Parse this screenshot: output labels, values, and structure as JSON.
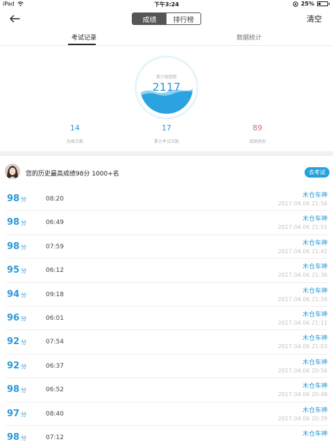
{
  "status_bar": {
    "device": "iPad",
    "time": "下午3:24",
    "battery": "25%"
  },
  "nav": {
    "segments": [
      "成绩",
      "排行榜"
    ],
    "active_segment": "成绩",
    "clear_label": "清空"
  },
  "tabs": [
    "考试记录",
    "数据统计"
  ],
  "summary": {
    "circle_label": "累计做题数",
    "circle_value": "2117",
    "stats": [
      {
        "value": "14",
        "label": "及格次数",
        "color": "#2a98d6"
      },
      {
        "value": "17",
        "label": "累计考试次数",
        "color": "#2a98d6"
      },
      {
        "value": "89",
        "label": "成绩预测",
        "color": "#e06a6a"
      }
    ]
  },
  "profile": {
    "best_text": "您的历史最高成绩98分  1000+名",
    "exam_button": "去考试"
  },
  "records": [
    {
      "score": "98",
      "unit": "分",
      "time": "08:20",
      "name": "木仓车神",
      "date": "2017.04.06 21:56"
    },
    {
      "score": "98",
      "unit": "分",
      "time": "06:49",
      "name": "木仓车神",
      "date": "2017.04.06 21:51"
    },
    {
      "score": "98",
      "unit": "分",
      "time": "07:59",
      "name": "木仓车神",
      "date": "2017.04.06 21:42"
    },
    {
      "score": "95",
      "unit": "分",
      "time": "06:12",
      "name": "木仓车神",
      "date": "2017.04.06 21:36"
    },
    {
      "score": "94",
      "unit": "分",
      "time": "09:18",
      "name": "木仓车神",
      "date": "2017.04.06 21:26"
    },
    {
      "score": "96",
      "unit": "分",
      "time": "06:01",
      "name": "木仓车神",
      "date": "2017.04.06 21:11"
    },
    {
      "score": "92",
      "unit": "分",
      "time": "07:54",
      "name": "木仓车神",
      "date": "2017.04.06 21:03"
    },
    {
      "score": "92",
      "unit": "分",
      "time": "06:37",
      "name": "木仓车神",
      "date": "2017.04.06 20:56"
    },
    {
      "score": "98",
      "unit": "分",
      "time": "06:52",
      "name": "木仓车神",
      "date": "2017.04.06 20:48"
    },
    {
      "score": "97",
      "unit": "分",
      "time": "08:40",
      "name": "木仓车神",
      "date": "2017.04.06 20:39"
    },
    {
      "score": "98",
      "unit": "分",
      "time": "07:12",
      "name": "木仓车神",
      "date": ""
    }
  ],
  "colors": {
    "accent": "#2a98d6",
    "button": "#24a2dc",
    "predict": "#e06a6a"
  }
}
